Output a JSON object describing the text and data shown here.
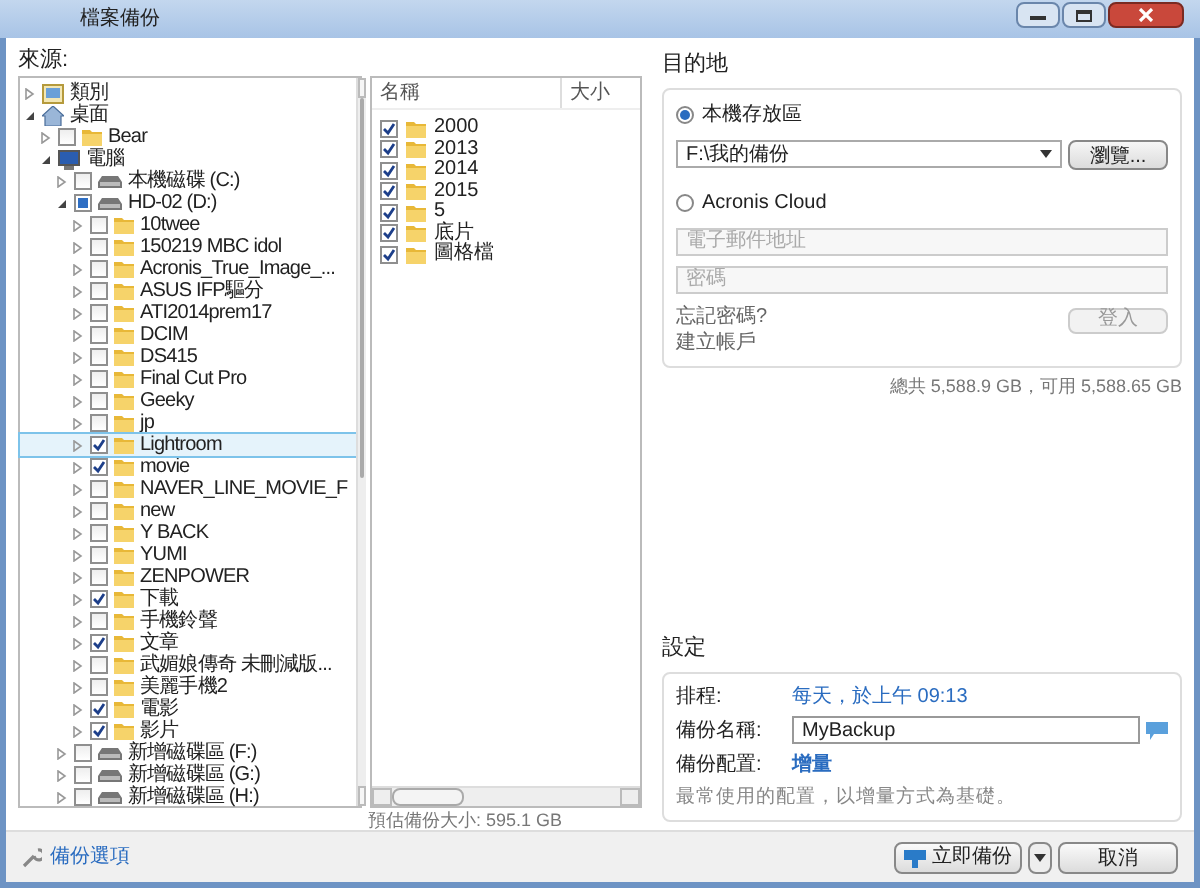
{
  "window": {
    "title": "檔案備份"
  },
  "source": {
    "label": "來源:",
    "tree": [
      {
        "kind": "library",
        "label": "類別",
        "expanded": false
      },
      {
        "kind": "home",
        "label": "桌面",
        "expanded": true,
        "children": [
          {
            "kind": "folder",
            "label": "Bear",
            "expanded": false,
            "checked": false
          },
          {
            "kind": "computer",
            "label": "電腦",
            "expanded": true,
            "children": [
              {
                "kind": "drive",
                "label": "本機磁碟 (C:)",
                "expanded": false,
                "checked": false
              },
              {
                "kind": "drive",
                "label": "HD-02 (D:)",
                "expanded": true,
                "checked": false,
                "partial": true,
                "children": [
                  {
                    "kind": "folder",
                    "label": "10twee",
                    "expanded": false,
                    "checked": false
                  },
                  {
                    "kind": "folder",
                    "label": "150219 MBC idol",
                    "expanded": false,
                    "checked": false
                  },
                  {
                    "kind": "folder",
                    "label": "Acronis_True_Image_...",
                    "expanded": false,
                    "checked": false
                  },
                  {
                    "kind": "folder",
                    "label": "ASUS IFP驅分",
                    "expanded": false,
                    "checked": false
                  },
                  {
                    "kind": "folder",
                    "label": "ATI2014prem17",
                    "expanded": false,
                    "checked": false
                  },
                  {
                    "kind": "folder",
                    "label": "DCIM",
                    "expanded": false,
                    "checked": false
                  },
                  {
                    "kind": "folder",
                    "label": "DS415",
                    "expanded": false,
                    "checked": false
                  },
                  {
                    "kind": "folder",
                    "label": "Final Cut Pro",
                    "expanded": false,
                    "checked": false
                  },
                  {
                    "kind": "folder",
                    "label": "Geeky",
                    "expanded": false,
                    "checked": false
                  },
                  {
                    "kind": "folder",
                    "label": "jp",
                    "expanded": false,
                    "checked": false
                  },
                  {
                    "kind": "folder",
                    "label": "Lightroom",
                    "expanded": false,
                    "checked": true,
                    "selected": true
                  },
                  {
                    "kind": "folder",
                    "label": "movie",
                    "expanded": false,
                    "checked": true
                  },
                  {
                    "kind": "folder",
                    "label": "NAVER_LINE_MOVIE_F",
                    "expanded": false,
                    "checked": false
                  },
                  {
                    "kind": "folder",
                    "label": "new",
                    "expanded": false,
                    "checked": false
                  },
                  {
                    "kind": "folder",
                    "label": "Y BACK",
                    "expanded": false,
                    "checked": false
                  },
                  {
                    "kind": "folder",
                    "label": "YUMI",
                    "expanded": false,
                    "checked": false
                  },
                  {
                    "kind": "folder",
                    "label": "ZENPOWER",
                    "expanded": false,
                    "checked": false
                  },
                  {
                    "kind": "folder",
                    "label": "下載",
                    "expanded": false,
                    "checked": true
                  },
                  {
                    "kind": "folder",
                    "label": "手機鈴聲",
                    "expanded": false,
                    "checked": false
                  },
                  {
                    "kind": "folder",
                    "label": "文章",
                    "expanded": false,
                    "checked": true
                  },
                  {
                    "kind": "folder",
                    "label": "武媚娘傳奇 未刪減版...",
                    "expanded": false,
                    "checked": false
                  },
                  {
                    "kind": "folder",
                    "label": "美麗手機2",
                    "expanded": false,
                    "checked": false
                  },
                  {
                    "kind": "folder",
                    "label": "電影",
                    "expanded": false,
                    "checked": true
                  },
                  {
                    "kind": "folder",
                    "label": "影片",
                    "expanded": false,
                    "checked": true
                  }
                ]
              },
              {
                "kind": "drive",
                "label": "新增磁碟區 (F:)",
                "expanded": false,
                "checked": false
              },
              {
                "kind": "drive",
                "label": "新增磁碟區 (G:)",
                "expanded": false,
                "checked": false
              },
              {
                "kind": "drive",
                "label": "新增磁碟區 (H:)",
                "expanded": false,
                "checked": false
              }
            ]
          }
        ]
      }
    ],
    "columns": [
      "名稱",
      "大小"
    ],
    "files": [
      {
        "name": "2000",
        "checked": true
      },
      {
        "name": "2013",
        "checked": true
      },
      {
        "name": "2014",
        "checked": true
      },
      {
        "name": "2015",
        "checked": true
      },
      {
        "name": "5",
        "checked": true
      },
      {
        "name": "底片",
        "checked": true
      },
      {
        "name": "圖格檔",
        "checked": true
      }
    ],
    "estimate": "預估備份大小: 595.1 GB"
  },
  "destination": {
    "label": "目的地",
    "local": {
      "label": "本機存放區",
      "selected": true,
      "path": "F:\\我的備份",
      "browse": "瀏覽..."
    },
    "cloud": {
      "label": "Acronis Cloud",
      "selected": false,
      "email_placeholder": "電子郵件地址",
      "password_placeholder": "密碼",
      "forgot": "忘記密碼?",
      "create": "建立帳戶",
      "login": "登入"
    },
    "capacity": "總共 5,588.9 GB，可用 5,588.65 GB"
  },
  "settings": {
    "label": "設定",
    "schedule_label": "排程:",
    "schedule": "每天，於上午 09:13",
    "name_label": "備份名稱:",
    "name": "MyBackup",
    "scheme_label": "備份配置:",
    "scheme": "增量",
    "scheme_note": "最常使用的配置，以增量方式為基礎。"
  },
  "footer": {
    "options": "備份選項",
    "backup_now": "立即備份",
    "cancel": "取消"
  }
}
